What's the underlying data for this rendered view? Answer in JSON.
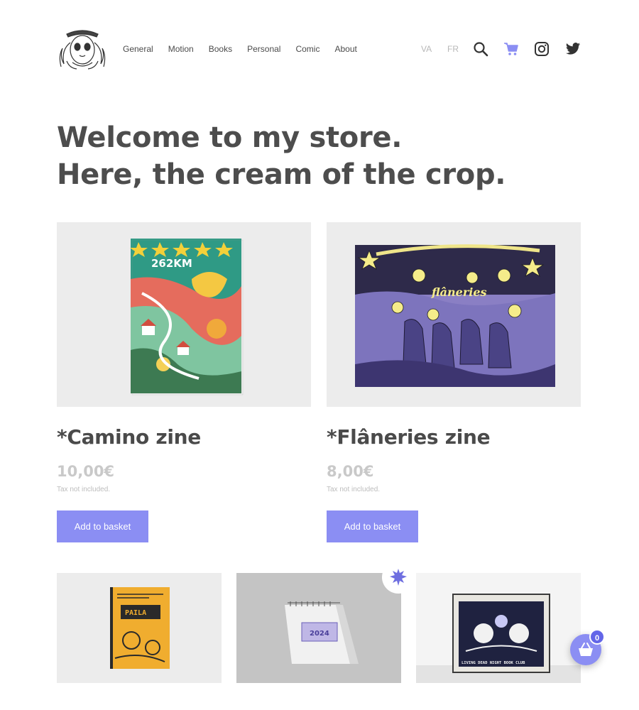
{
  "header": {
    "logo_icon": "illustrated-face-logo-icon",
    "nav": [
      "General",
      "Motion",
      "Books",
      "Personal",
      "Comic",
      "About"
    ],
    "languages": [
      "VA",
      "FR"
    ],
    "icons": [
      "search-icon",
      "cart-icon",
      "instagram-icon",
      "twitter-icon"
    ],
    "cart_icon_color": "#8b8ef3"
  },
  "hero": {
    "line1": "Welcome to my store.",
    "line2": "Here, the cream of the crop."
  },
  "products": [
    {
      "title": "*Camino zine",
      "price": "10,00€",
      "tax_note": "Tax not included.",
      "button": "Add to basket",
      "cover_text": "262KM"
    },
    {
      "title": "*Flâneries zine",
      "price": "8,00€",
      "tax_note": "Tax not included.",
      "button": "Add to basket",
      "cover_text": "flâneries"
    }
  ],
  "more_products": [
    {
      "image": "yellow-zine-cover",
      "cover_text": "PAILA"
    },
    {
      "image": "desk-calendar",
      "cover_text": "2024"
    },
    {
      "image": "framed-print",
      "cover_text": "LIVING DEAD NIGHT BOOK CLUB"
    }
  ],
  "basket": {
    "count": "0",
    "icon": "basket-icon",
    "color": "#8b8ef3"
  },
  "colors": {
    "accent": "#8b8ef3",
    "text": "#4a4a4a",
    "muted": "#c9c9c9"
  }
}
